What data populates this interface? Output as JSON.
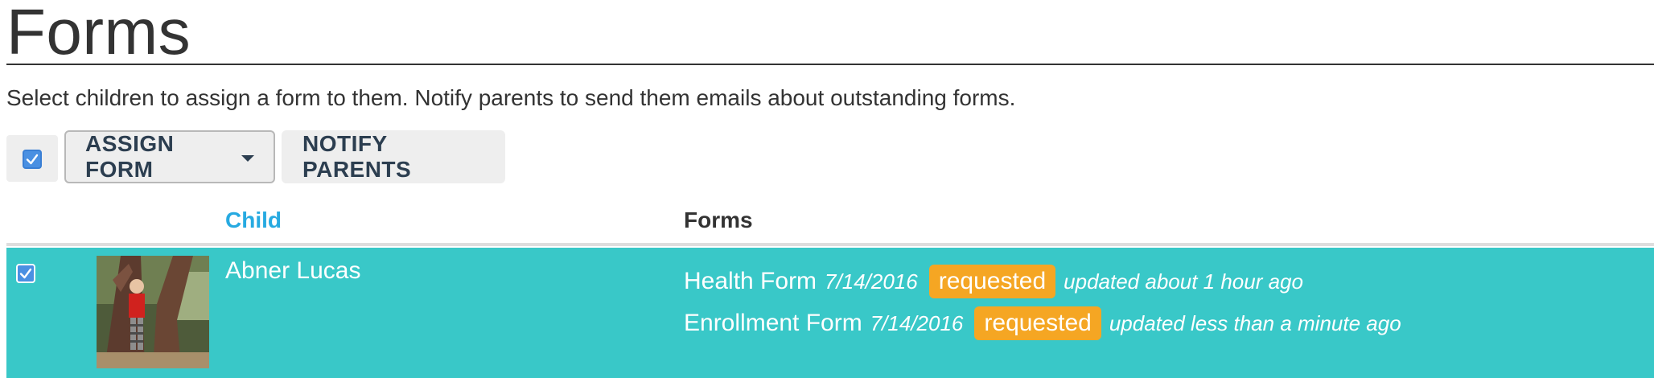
{
  "header": {
    "title": "Forms",
    "description": "Select children to assign a form to them. Notify parents to send them emails about outstanding forms."
  },
  "toolbar": {
    "select_all_checked": true,
    "assign_form_label": "ASSIGN FORM",
    "notify_parents_label": "NOTIFY PARENTS"
  },
  "table": {
    "columns": [
      "Child",
      "Forms"
    ],
    "rows": [
      {
        "checked": true,
        "child_name": "Abner Lucas",
        "forms": [
          {
            "name": "Health Form",
            "date": "7/14/2016",
            "status": "requested",
            "updated": "updated about 1 hour ago"
          },
          {
            "name": "Enrollment Form",
            "date": "7/14/2016",
            "status": "requested",
            "updated": "updated less than a minute ago"
          }
        ]
      }
    ]
  },
  "colors": {
    "accent": "#27aae1",
    "row_selected": "#39c8c8",
    "status_requested": "#f5a623",
    "checkbox": "#4a90e2"
  },
  "icons": {
    "checkbox": "checkbox-checked-icon",
    "dropdown": "caret-down-icon"
  }
}
